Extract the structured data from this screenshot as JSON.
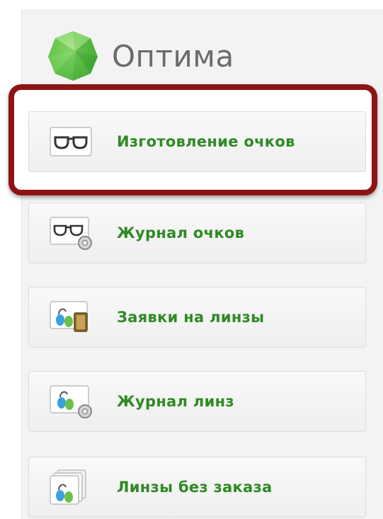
{
  "app": {
    "title": "Оптима"
  },
  "colors": {
    "accent_text": "#2f8a24",
    "highlight_border": "#8d1414",
    "logo_green": "#4fb83a"
  },
  "menu": {
    "items": [
      {
        "label": "Изготовление очков",
        "icon": "glasses-icon",
        "highlighted": true
      },
      {
        "label": "Журнал очков",
        "icon": "glasses-journal-icon",
        "highlighted": false
      },
      {
        "label": "Заявки на линзы",
        "icon": "lens-orders-icon",
        "highlighted": false
      },
      {
        "label": "Журнал линз",
        "icon": "lens-journal-icon",
        "highlighted": false
      },
      {
        "label": "Линзы без заказа",
        "icon": "lenses-without-order-icon",
        "highlighted": false
      }
    ]
  }
}
